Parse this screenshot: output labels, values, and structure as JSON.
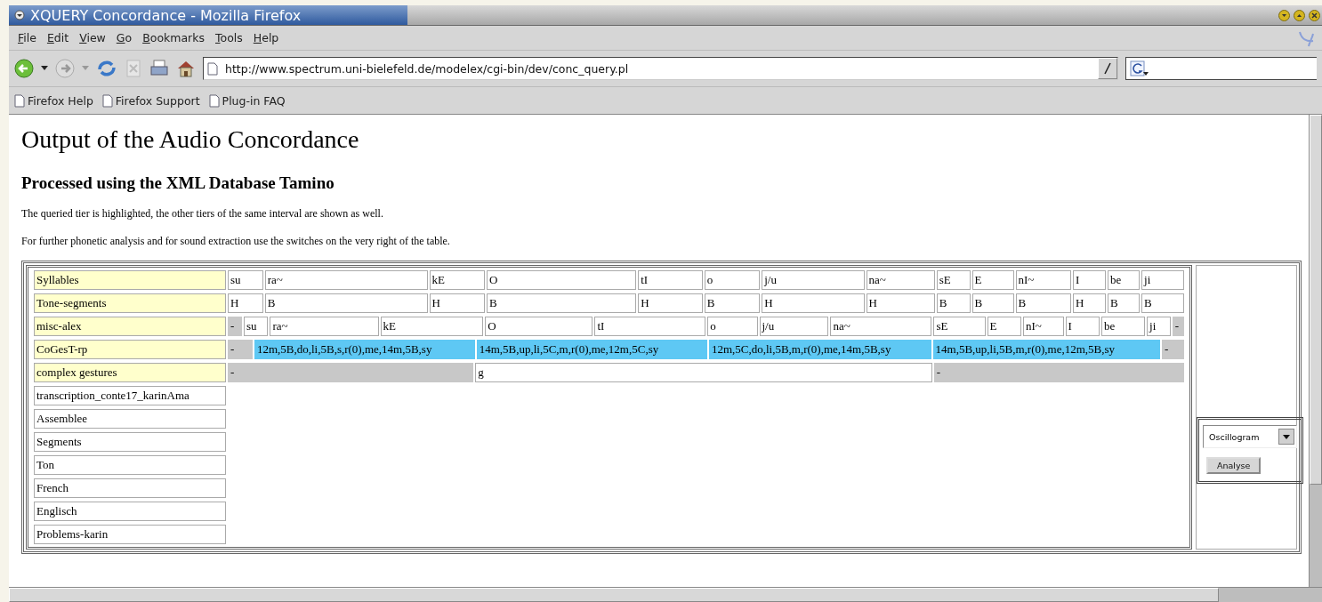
{
  "window": {
    "title": "XQUERY Concordance - Mozilla Firefox"
  },
  "menu": [
    "File",
    "Edit",
    "View",
    "Go",
    "Bookmarks",
    "Tools",
    "Help"
  ],
  "address": {
    "value": "http://www.spectrum.uni-bielefeld.de/modelex/cgi-bin/dev/conc_query.pl"
  },
  "bookmarks": [
    "Firefox Help",
    "Firefox Support",
    "Plug-in FAQ"
  ],
  "page": {
    "heading": "Output of the Audio Concordance",
    "subheading": "Processed using the XML Database Tamino",
    "paragraphs": [
      "The queried tier is highlighted, the other tiers of the same interval are shown as well.",
      "For further phonetic analysis and for sound extraction use the switches on the very right of the table."
    ]
  },
  "tiers": [
    {
      "label": "Syllables",
      "active": true,
      "cells": [
        {
          "kind": "text",
          "text": "su"
        },
        {
          "kind": "text",
          "text": "ra~"
        },
        {
          "kind": "text",
          "text": "kE"
        },
        {
          "kind": "text",
          "text": "O"
        },
        {
          "kind": "text",
          "text": "tI"
        },
        {
          "kind": "text",
          "text": "o"
        },
        {
          "kind": "text",
          "text": "j/u"
        },
        {
          "kind": "text",
          "text": "na~"
        },
        {
          "kind": "text",
          "text": "sE"
        },
        {
          "kind": "text",
          "text": "E"
        },
        {
          "kind": "text",
          "text": "nI~"
        },
        {
          "kind": "text",
          "text": "I"
        },
        {
          "kind": "text",
          "text": "be"
        },
        {
          "kind": "text",
          "text": "ji"
        }
      ]
    },
    {
      "label": "Tone-segments",
      "active": true,
      "cells": [
        {
          "kind": "text",
          "text": "H"
        },
        {
          "kind": "text",
          "text": "B"
        },
        {
          "kind": "text",
          "text": "H"
        },
        {
          "kind": "text",
          "text": "B"
        },
        {
          "kind": "text",
          "text": "H"
        },
        {
          "kind": "text",
          "text": "B"
        },
        {
          "kind": "text",
          "text": "H"
        },
        {
          "kind": "text",
          "text": "H"
        },
        {
          "kind": "text",
          "text": "B"
        },
        {
          "kind": "text",
          "text": "B"
        },
        {
          "kind": "text",
          "text": "B"
        },
        {
          "kind": "text",
          "text": "H"
        },
        {
          "kind": "text",
          "text": "B"
        },
        {
          "kind": "text",
          "text": "B"
        }
      ]
    },
    {
      "label": "misc-alex",
      "active": true,
      "cells": [
        {
          "kind": "gap",
          "text": "-"
        },
        {
          "kind": "text",
          "text": "su"
        },
        {
          "kind": "text",
          "text": "ra~"
        },
        {
          "kind": "text",
          "text": "kE"
        },
        {
          "kind": "text",
          "text": "O"
        },
        {
          "kind": "text",
          "text": "tI"
        },
        {
          "kind": "text",
          "text": "o"
        },
        {
          "kind": "text",
          "text": "j/u"
        },
        {
          "kind": "text",
          "text": "na~"
        },
        {
          "kind": "text",
          "text": "sE"
        },
        {
          "kind": "text",
          "text": "E"
        },
        {
          "kind": "text",
          "text": "nI~"
        },
        {
          "kind": "text",
          "text": "I"
        },
        {
          "kind": "text",
          "text": "be"
        },
        {
          "kind": "text",
          "text": "ji"
        },
        {
          "kind": "gap",
          "text": "-"
        }
      ]
    },
    {
      "label": "CoGesT-rp",
      "active": true,
      "cells": [
        {
          "kind": "gap",
          "text": "-"
        },
        {
          "kind": "highlighted",
          "text": "12m,5B,do,li,5B,s,r(0),me,14m,5B,sy"
        },
        {
          "kind": "highlighted",
          "text": "14m,5B,up,li,5C,m,r(0),me,12m,5C,sy"
        },
        {
          "kind": "highlighted",
          "text": "12m,5C,do,li,5B,m,r(0),me,14m,5B,sy"
        },
        {
          "kind": "highlighted",
          "text": "14m,5B,up,li,5B,m,r(0),me,12m,5B,sy"
        },
        {
          "kind": "gap",
          "text": "-"
        }
      ]
    },
    {
      "label": "complex gestures",
      "active": true,
      "cells": [
        {
          "kind": "gap",
          "text": "-"
        },
        {
          "kind": "text",
          "text": "g"
        },
        {
          "kind": "gap",
          "text": "-"
        }
      ]
    },
    {
      "label": "transcription_conte17_karinAma",
      "active": false
    },
    {
      "label": "Assemblee",
      "active": false
    },
    {
      "label": "Segments",
      "active": false
    },
    {
      "label": "Ton",
      "active": false
    },
    {
      "label": "French",
      "active": false
    },
    {
      "label": "Englisch",
      "active": false
    },
    {
      "label": "Problems-karin",
      "active": false
    }
  ],
  "analysis": {
    "select": "Oscillogram",
    "button": "Analyse"
  }
}
